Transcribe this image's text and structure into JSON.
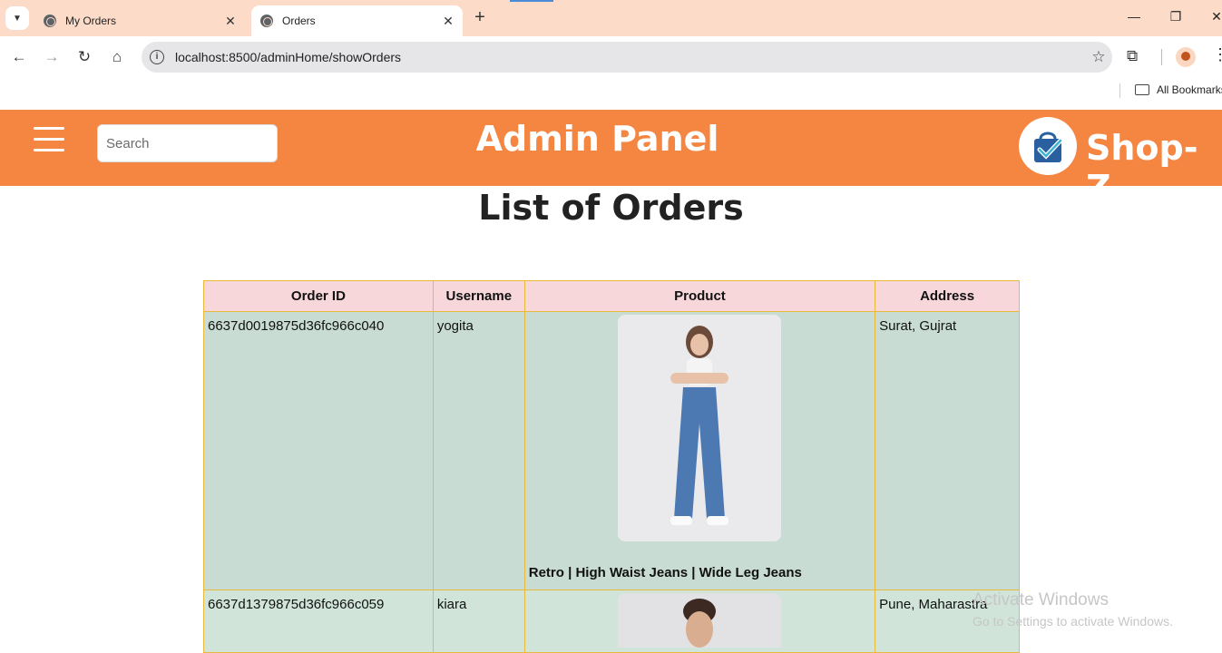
{
  "browser": {
    "tabs": [
      {
        "label": "My Orders"
      },
      {
        "label": "Orders"
      }
    ],
    "url": "localhost:8500/adminHome/showOrders",
    "bookmarks_label": "All Bookmarks"
  },
  "header": {
    "search_placeholder": "Search",
    "title": "Admin Panel",
    "brand": "Shop-Z"
  },
  "page": {
    "title": "List of Orders"
  },
  "table": {
    "columns": [
      "Order ID",
      "Username",
      "Product",
      "Address"
    ],
    "rows": [
      {
        "order_id": "6637d0019875d36fc966c040",
        "username": "yogita",
        "product": "Retro | High Waist Jeans | Wide Leg Jeans",
        "address": "Surat, Gujrat"
      },
      {
        "order_id": "6637d1379875d36fc966c059",
        "username": "kiara",
        "product": "",
        "address": "Pune, Maharastra"
      }
    ]
  },
  "watermark": {
    "line1": "Activate Windows",
    "line2": "Go to Settings to activate Windows."
  },
  "colors": {
    "header_bg": "#f58642",
    "tab_strip": "#fcdcc8",
    "table_header": "#f8d7da",
    "table_cell": "#c8dcd3",
    "table_border": "#e8b93a"
  }
}
